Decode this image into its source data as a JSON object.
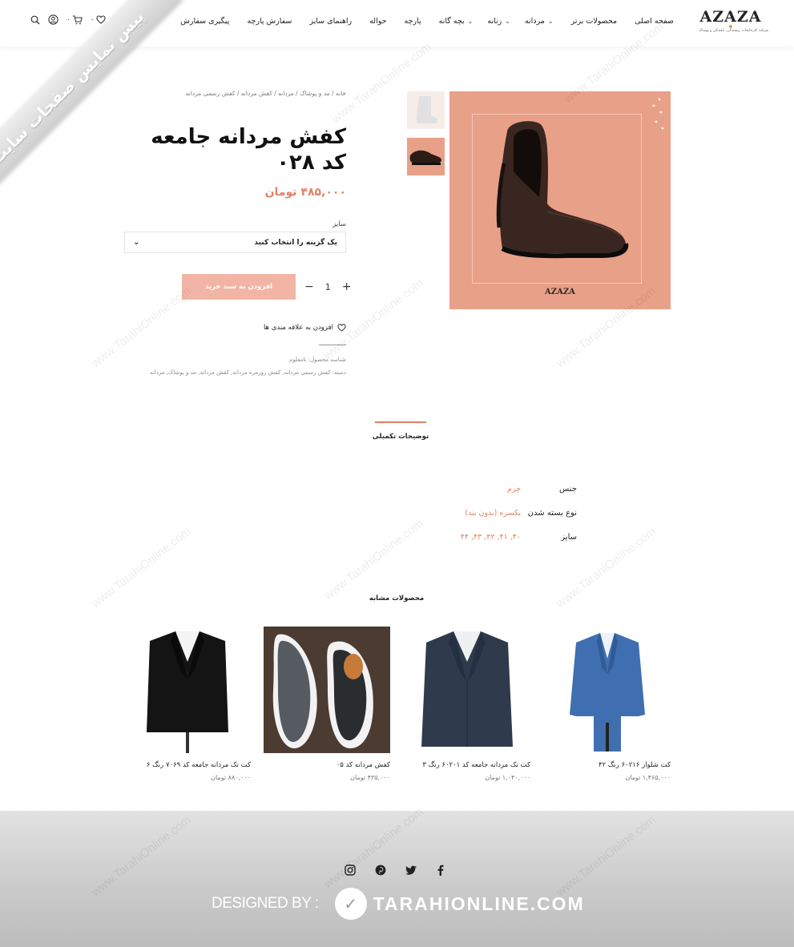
{
  "ribbon": {
    "text": "پیش نمایش صفحات سایت"
  },
  "logo": {
    "mark": "AZAZA",
    "sub": "شرکت کارخانجات ریسندگی، بافندگی و پوشاک"
  },
  "nav": {
    "items": [
      {
        "label": "صفحه اصلی",
        "dropdown": false
      },
      {
        "label": "محصولات برتر",
        "dropdown": false
      },
      {
        "label": "مردانه",
        "dropdown": true
      },
      {
        "label": "زنانه",
        "dropdown": true
      },
      {
        "label": "بچه گانه",
        "dropdown": true
      },
      {
        "label": "پارچه",
        "dropdown": false
      },
      {
        "label": "حواله",
        "dropdown": false
      },
      {
        "label": "راهنمای سایز",
        "dropdown": false
      },
      {
        "label": "سفارش پارچه",
        "dropdown": false
      },
      {
        "label": "پیگیری سفارش",
        "dropdown": false
      }
    ]
  },
  "header": {
    "cart_count": "۰",
    "wishlist_count": "۰"
  },
  "breadcrumb": "خانه  /  مد و پوشاک  /  مردانه  /  کفش مردانه  /  کفش رسمی مردانه",
  "product": {
    "title": "کفش مردانه جامعه کد ۰۲۸",
    "price": "۴۸۵,۰۰۰ تومان",
    "size_label": "سایز",
    "size_placeholder": "یک گزینه را انتخاب کنید",
    "qty": "1",
    "add_to_cart": "افزودن به سبد خرید",
    "wishlist": "افزودن به علاقه مندی ها",
    "sku": "شناسه محصول: نامعلوم",
    "categories": "دسته: کفش رسمی مردانه, کفش روزمره مردانه, کفش مردانه, مد و پوشاک, مردانه",
    "image_logo": "AZAZA"
  },
  "tabs": {
    "active": "توضیحات تکمیلی"
  },
  "attributes": [
    {
      "key": "جنس",
      "value": "چرم"
    },
    {
      "key": "نوع بسته شدن",
      "value": "یکسره (بدون بند)"
    },
    {
      "key": "سایز",
      "value": "۴۰, ۴۱, ۴۲, ۴۳, ۴۴"
    }
  ],
  "related": {
    "title": "محصولات مشابه",
    "items": [
      {
        "name": "کت شلوار ۶۰۲۱۶ رنگ ۴۲",
        "price": "۱,۴۶۵,۰۰۰ تومان"
      },
      {
        "name": "کت تک مردانه جامعه کد ۶۰۲۰۱ رنگ ۳",
        "price": "۱,۰۴۰,۰۰۰ تومان"
      },
      {
        "name": "کفش مردانه کد ۰۵",
        "price": "۴۳۵,۰۰۰ تومان"
      },
      {
        "name": "کت تک مردانه جامعه کد ۷۰۶۹ رنگ ۶",
        "price": "۸۸۰,۰۰۰ تومان"
      }
    ]
  },
  "footer": {
    "designed_by": "DESIGNED BY :",
    "brand": "TARAHIONLINE.COM"
  },
  "watermark": "www.TarahiOnline.com",
  "colors": {
    "accent": "#e0826a",
    "product_bg": "#e8a088",
    "button": "#f0a38f"
  }
}
